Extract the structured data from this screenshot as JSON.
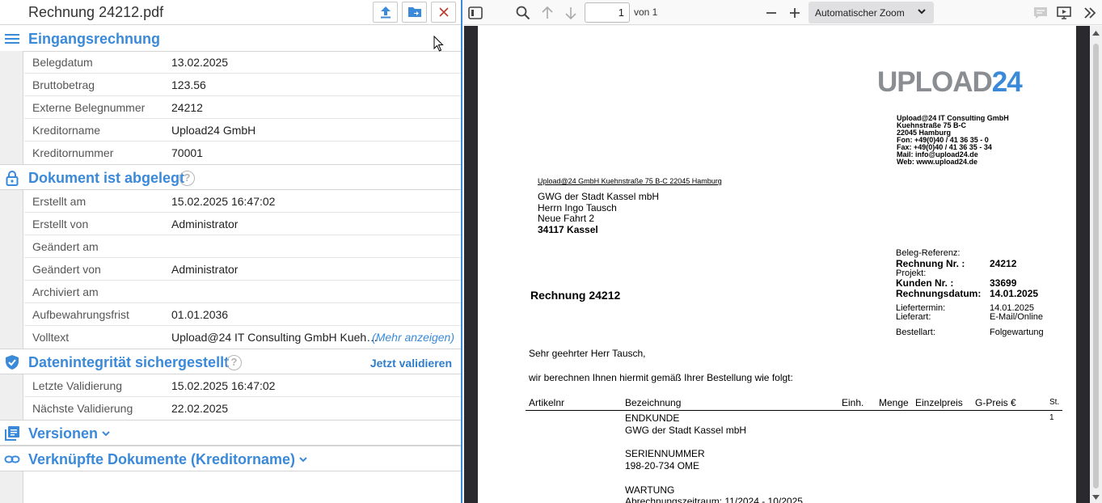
{
  "header": {
    "filename": "Rechnung 24212.pdf",
    "upload_icon": "upload-icon",
    "folder_icon": "folder-arrow-icon",
    "close_icon": "close-icon"
  },
  "sections": {
    "invoice": {
      "title": "Eingangsrechnung",
      "rows": [
        {
          "label": "Belegdatum",
          "value": "13.02.2025"
        },
        {
          "label": "Bruttobetrag",
          "value": "123.56"
        },
        {
          "label": "Externe Belegnummer",
          "value": "24212"
        },
        {
          "label": "Kreditorname",
          "value": "Upload24 GmbH"
        },
        {
          "label": "Kreditornummer",
          "value": "70001"
        }
      ]
    },
    "archived": {
      "title": "Dokument ist abgelegt",
      "help": "?",
      "rows": [
        {
          "label": "Erstellt am",
          "value": "15.02.2025 16:47:02"
        },
        {
          "label": "Erstellt von",
          "value": "Administrator"
        },
        {
          "label": "Geändert am",
          "value": ""
        },
        {
          "label": "Geändert von",
          "value": "Administrator"
        },
        {
          "label": "Archiviert am",
          "value": ""
        },
        {
          "label": "Aufbewahrungsfrist",
          "value": "01.01.2036"
        },
        {
          "label": "Volltext",
          "value": "Upload@24 IT Consulting GmbH Kueh…",
          "more": "(Mehr anzeigen)"
        }
      ]
    },
    "integrity": {
      "title": "Datenintegrität sichergestellt",
      "help": "?",
      "action": "Jetzt validieren",
      "rows": [
        {
          "label": "Letzte Validierung",
          "value": "15.02.2025 16:47:02"
        },
        {
          "label": "Nächste Validierung",
          "value": "22.02.2025"
        }
      ]
    },
    "versions": {
      "title": "Versionen"
    },
    "linked": {
      "title": "Verknüpfte Dokumente (Kreditorname)"
    }
  },
  "viewer": {
    "page_current": "1",
    "page_total": "von 1",
    "zoom_label": "Automatischer Zoom"
  },
  "pdf": {
    "logo_a": "UPLOAD",
    "logo_b": "24",
    "sender_block": [
      "Upload@24 IT Consulting GmbH",
      "Kuehnstraße 75 B-C",
      "22045 Hamburg",
      "Fon: +49(0)40 / 41 36 35 - 0",
      "Fax: +49(0)40 / 41 36 35 - 34",
      "Mail: info@upload24.de",
      "Web: www.upload24.de"
    ],
    "return_line": "Upload@24 GmbH  Kuehnstraße 75 B-C  22045 Hamburg",
    "recipient": [
      "GWG der Stadt Kassel mbH",
      "Herrn Ingo Tausch",
      "Neue Fahrt 2"
    ],
    "recipient_city": "34117 Kassel",
    "title": "Rechnung 24212",
    "meta_ref": "Beleg-Referenz:",
    "meta_invoice_label": "Rechnung Nr. :",
    "meta_invoice_value": "24212",
    "meta_project": "Projekt:",
    "meta_customer_label": "Kunden Nr. :",
    "meta_customer_value": "33699",
    "meta_date_label": "Rechnungsdatum:",
    "meta_date_value": "14.01.2025",
    "meta_delivery_label": "Liefertermin:",
    "meta_delivery_value": "14.01.2025",
    "meta_type_label": "Lieferart:",
    "meta_type_value": "E-Mail/Online",
    "meta_order_label": "Bestellart:",
    "meta_order_value": "Folgewartung",
    "salutation": "Sehr geehrter Herr Tausch,",
    "intro": "wir berechnen Ihnen hiermit gemäß Ihrer Bestellung wie folgt:",
    "columns": [
      "Artikelnr",
      "Bezeichnung",
      "Einh.",
      "Menge",
      "Einzelpreis",
      "G-Preis €",
      "St."
    ],
    "line1": "ENDKUNDE",
    "line2": "GWG der Stadt Kassel mbH",
    "line_st": "1",
    "line3": "SERIENNUMMER",
    "line4": "198-20-734 OME",
    "line5": "WARTUNG",
    "line6": "Abrechnungszeitraum: 11/2024 - 10/2025"
  }
}
